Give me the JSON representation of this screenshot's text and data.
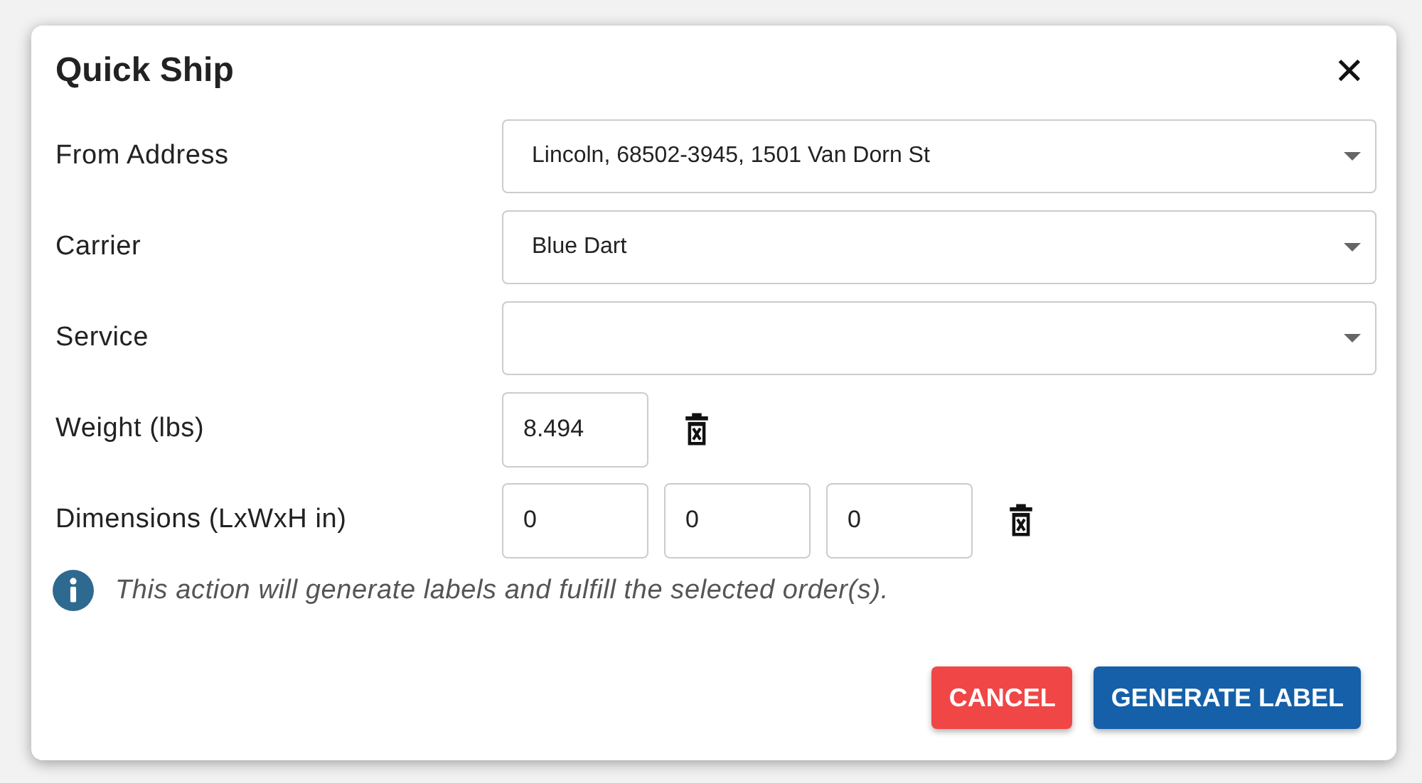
{
  "dialog": {
    "title": "Quick Ship",
    "close_icon": "✕"
  },
  "fields": [
    {
      "kind": "select",
      "label": "From Address",
      "value": "Lincoln, 68502-3945, 1501 Van Dorn St"
    },
    {
      "kind": "select",
      "label": "Carrier",
      "value": "Blue Dart"
    },
    {
      "kind": "select",
      "label": "Service"
    },
    {
      "kind": "inputs",
      "label": "Weight (lbs)",
      "values": [
        "8.494"
      ]
    },
    {
      "kind": "inputs",
      "label": "Dimensions (LxWxH in)",
      "values": [
        "0",
        "0",
        "0"
      ]
    }
  ],
  "notice": "This action will generate labels and fulfill the selected order(s).",
  "buttons": [
    {
      "kind": "cancel",
      "label": "CANCEL"
    },
    {
      "kind": "primary",
      "label": "GENERATE LABEL"
    }
  ]
}
